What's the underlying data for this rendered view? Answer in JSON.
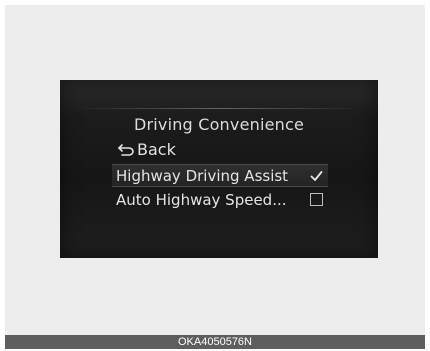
{
  "screen": {
    "title": "Driving Convenience",
    "back_label": "Back",
    "items": [
      {
        "label": "Highway Driving Assist",
        "checked": true,
        "selected": true
      },
      {
        "label": "Auto Highway Speed...",
        "checked": false,
        "selected": false
      }
    ]
  },
  "caption": "OKA4050576N",
  "icons": {
    "back": "back-arrow-icon",
    "check": "checkmark-icon",
    "unchecked": "empty-checkbox-icon"
  },
  "colors": {
    "screen_bg": "#161616",
    "text": "#e4e4e4",
    "frame_bg": "#ededed",
    "caption_bg": "#5e5e5e"
  }
}
